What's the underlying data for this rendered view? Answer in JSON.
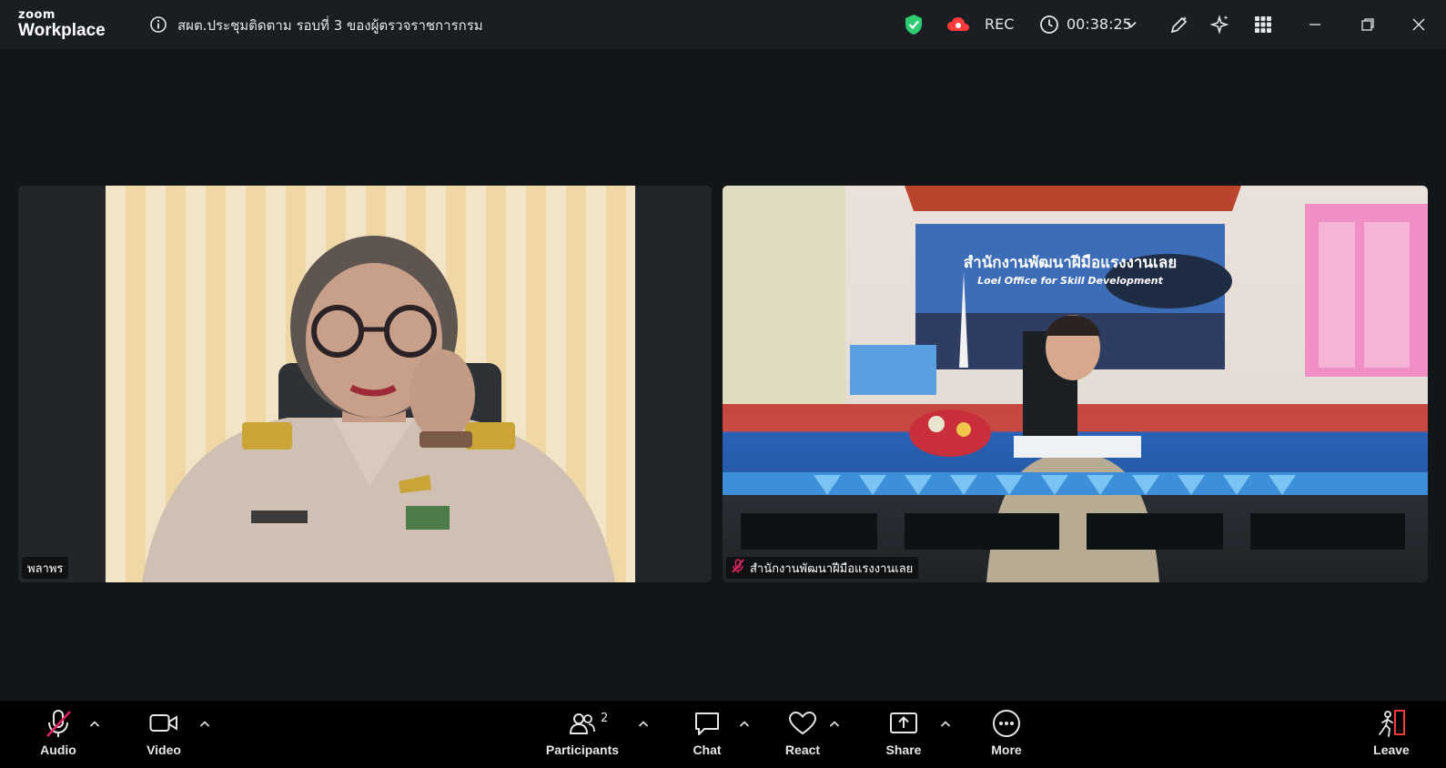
{
  "app": {
    "logo_line1": "zoom",
    "logo_line2": "Workplace",
    "meeting_title": "สผต.ประชุมติดตาม รอบที่ 3 ของผู้ตรวจราชการกรม",
    "rec_label": "REC",
    "timer": "00:38:25"
  },
  "colors": {
    "shield": "#2ecc71",
    "rec_cloud": "#ff3b3b",
    "muted": "#e0245e",
    "leave": "#ff3b3b"
  },
  "participants": [
    {
      "name": "พลาพร",
      "muted": false
    },
    {
      "name": "สำนักงานพัฒนาฝีมือแรงงานเลย",
      "muted": true
    }
  ],
  "video_overlay": {
    "banner_th": "สำนักงานพัฒนาฝีมือแรงงานเลย",
    "banner_en": "Loei Office for Skill Development"
  },
  "toolbar": {
    "audio": "Audio",
    "video": "Video",
    "participants": "Participants",
    "participants_count": "2",
    "chat": "Chat",
    "react": "React",
    "share": "Share",
    "more": "More",
    "leave": "Leave"
  }
}
